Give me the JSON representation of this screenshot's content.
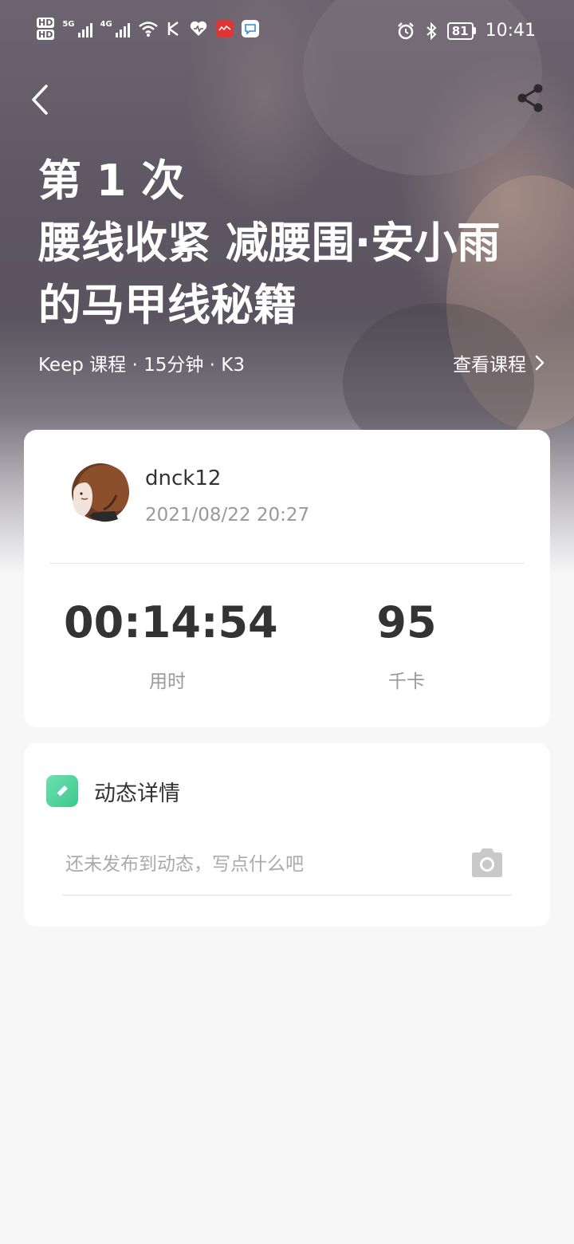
{
  "status_bar": {
    "hd1": "HD",
    "hd2": "HD",
    "net1": "5G",
    "net2": "4G",
    "battery": "81",
    "time": "10:41"
  },
  "course": {
    "attempt": "第 1 次",
    "title_line1": "腰线收紧 减腰围·安小雨",
    "title_line2": "的马甲线秘籍",
    "meta": "Keep 课程 · 15分钟 · K3",
    "view_course": "查看课程"
  },
  "record": {
    "username": "dnck12",
    "datetime": "2021/08/22 20:27",
    "duration_value": "00:14:54",
    "duration_label": "用时",
    "calories_value": "95",
    "calories_label": "千卡"
  },
  "post": {
    "title": "动态详情",
    "placeholder": "还未发布到动态，写点什么吧"
  }
}
